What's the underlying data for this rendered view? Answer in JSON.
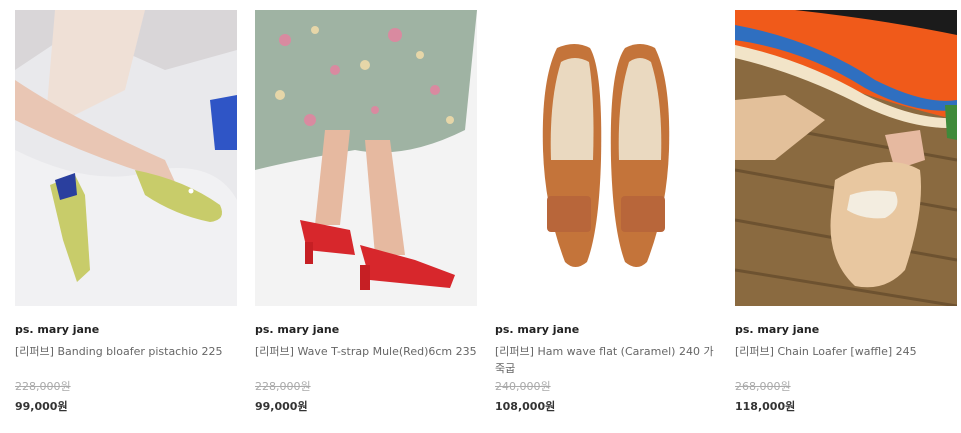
{
  "products": [
    {
      "brand": "ps. mary jane",
      "name": "[리퍼브] Banding bloafer pistachio 225",
      "original_price": "228,000원",
      "sale_price": "99,000원"
    },
    {
      "brand": "ps. mary jane",
      "name": "[리퍼브] Wave T-strap Mule(Red)6cm 235",
      "original_price": "228,000원",
      "sale_price": "99,000원"
    },
    {
      "brand": "ps. mary jane",
      "name": "[리퍼브] Ham wave flat (Caramel) 240 가죽굽",
      "original_price": "240,000원",
      "sale_price": "108,000원"
    },
    {
      "brand": "ps. mary jane",
      "name": "[리퍼브] Chain Loafer [waffle] 245",
      "original_price": "268,000원",
      "sale_price": "118,000원"
    }
  ]
}
